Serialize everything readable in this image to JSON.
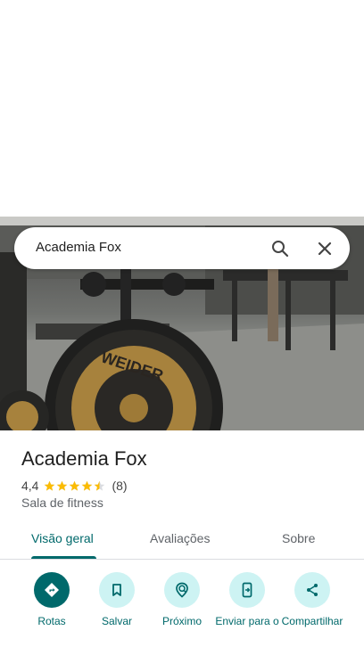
{
  "search": {
    "query": "Academia Fox"
  },
  "place": {
    "title": "Academia Fox",
    "rating": "4,4",
    "stars": 4.5,
    "reviews": "(8)",
    "category": "Sala de fitness",
    "photo_text": "WEIDER"
  },
  "tabs": [
    {
      "label": "Visão geral",
      "active": true
    },
    {
      "label": "Avaliações",
      "active": false
    },
    {
      "label": "Sobre",
      "active": false
    }
  ],
  "actions": [
    {
      "label": "Rotas",
      "icon": "directions-icon"
    },
    {
      "label": "Salvar",
      "icon": "bookmark-icon"
    },
    {
      "label": "Próximo",
      "icon": "nearby-icon"
    },
    {
      "label": "Enviar para o",
      "icon": "send-to-phone-icon"
    },
    {
      "label": "Compartilhar",
      "icon": "share-icon"
    }
  ],
  "colors": {
    "accent": "#00696b",
    "accent_light": "#cdf3f3",
    "star": "#fbbc04"
  }
}
